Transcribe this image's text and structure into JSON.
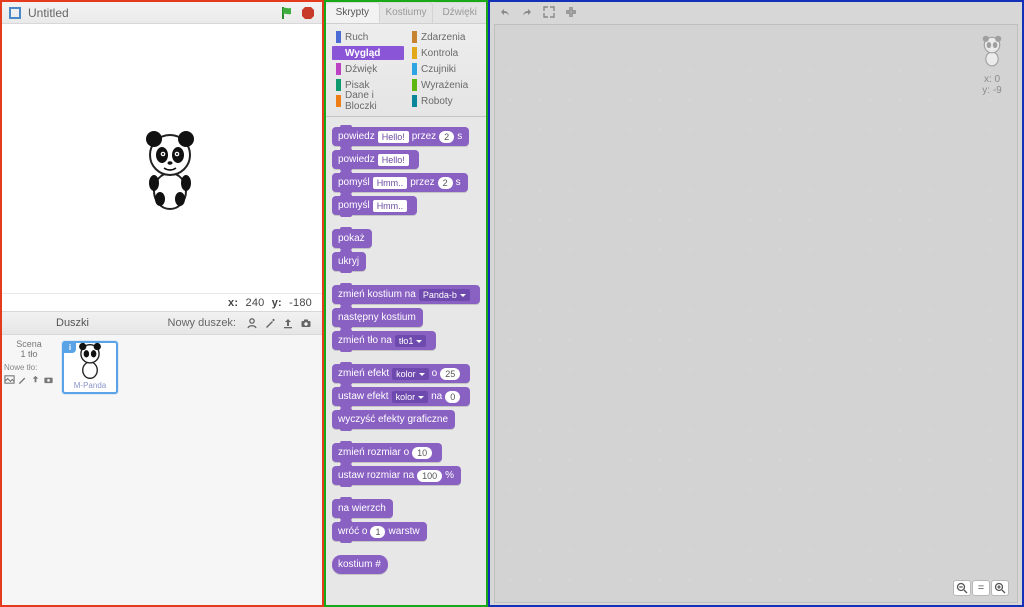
{
  "stage": {
    "title": "Untitled",
    "coords": {
      "x_label": "x:",
      "x": "240",
      "y_label": "y:",
      "y": "-180"
    }
  },
  "sprite_bar": {
    "title": "Duszki",
    "new_sprite_label": "Nowy duszek:"
  },
  "scene": {
    "label": "Scena",
    "sub": "1 tło",
    "new_bg_label": "Nowe tło:"
  },
  "sprite_thumb": {
    "label": "M-Panda",
    "badge": "i"
  },
  "tabs": [
    "Skrypty",
    "Kostiumy",
    "Dźwięki"
  ],
  "categories": [
    {
      "name": "Ruch",
      "color": "#4a6cd4"
    },
    {
      "name": "Zdarzenia",
      "color": "#c88330"
    },
    {
      "name": "Wygląd",
      "color": "#8a55d7",
      "selected": true
    },
    {
      "name": "Kontrola",
      "color": "#e1a91a"
    },
    {
      "name": "Dźwięk",
      "color": "#bb42c3"
    },
    {
      "name": "Czujniki",
      "color": "#2ca5e2"
    },
    {
      "name": "Pisak",
      "color": "#0e9a6c"
    },
    {
      "name": "Wyrażenia",
      "color": "#5cb712"
    },
    {
      "name": "Dane i Bloczki",
      "color": "#ee7d16"
    },
    {
      "name": "Roboty",
      "color": "#0a8698"
    }
  ],
  "blocks": [
    [
      {
        "parts": [
          {
            "t": "txt",
            "v": "powiedz"
          },
          {
            "t": "text",
            "v": "Hello!"
          },
          {
            "t": "txt",
            "v": "przez"
          },
          {
            "t": "num",
            "v": "2"
          },
          {
            "t": "txt",
            "v": "s"
          }
        ]
      },
      {
        "parts": [
          {
            "t": "txt",
            "v": "powiedz"
          },
          {
            "t": "text",
            "v": "Hello!"
          }
        ]
      },
      {
        "parts": [
          {
            "t": "txt",
            "v": "pomyśl"
          },
          {
            "t": "text",
            "v": "Hmm.."
          },
          {
            "t": "txt",
            "v": "przez"
          },
          {
            "t": "num",
            "v": "2"
          },
          {
            "t": "txt",
            "v": "s"
          }
        ]
      },
      {
        "parts": [
          {
            "t": "txt",
            "v": "pomyśl"
          },
          {
            "t": "text",
            "v": "Hmm.."
          }
        ]
      }
    ],
    [
      {
        "parts": [
          {
            "t": "txt",
            "v": "pokaż"
          }
        ]
      },
      {
        "parts": [
          {
            "t": "txt",
            "v": "ukryj"
          }
        ]
      }
    ],
    [
      {
        "parts": [
          {
            "t": "txt",
            "v": "zmień kostium na"
          },
          {
            "t": "menu",
            "v": "Panda-b"
          }
        ]
      },
      {
        "parts": [
          {
            "t": "txt",
            "v": "następny kostium"
          }
        ]
      },
      {
        "parts": [
          {
            "t": "txt",
            "v": "zmień tło na"
          },
          {
            "t": "menu",
            "v": "tło1"
          }
        ]
      }
    ],
    [
      {
        "parts": [
          {
            "t": "txt",
            "v": "zmień efekt"
          },
          {
            "t": "menu",
            "v": "kolor"
          },
          {
            "t": "txt",
            "v": "o"
          },
          {
            "t": "num",
            "v": "25"
          }
        ]
      },
      {
        "parts": [
          {
            "t": "txt",
            "v": "ustaw efekt"
          },
          {
            "t": "menu",
            "v": "kolor"
          },
          {
            "t": "txt",
            "v": "na"
          },
          {
            "t": "num",
            "v": "0"
          }
        ]
      },
      {
        "parts": [
          {
            "t": "txt",
            "v": "wyczyść efekty graficzne"
          }
        ]
      }
    ],
    [
      {
        "parts": [
          {
            "t": "txt",
            "v": "zmień rozmiar o"
          },
          {
            "t": "num",
            "v": "10"
          }
        ]
      },
      {
        "parts": [
          {
            "t": "txt",
            "v": "ustaw rozmiar na"
          },
          {
            "t": "num",
            "v": "100"
          },
          {
            "t": "txt",
            "v": "%"
          }
        ]
      }
    ],
    [
      {
        "parts": [
          {
            "t": "txt",
            "v": "na wierzch"
          }
        ]
      },
      {
        "parts": [
          {
            "t": "txt",
            "v": "wróć o"
          },
          {
            "t": "num",
            "v": "1"
          },
          {
            "t": "txt",
            "v": "warstw"
          }
        ]
      }
    ],
    [
      {
        "shape": "reporter",
        "parts": [
          {
            "t": "txt",
            "v": "kostium #"
          }
        ]
      }
    ]
  ],
  "script_info": {
    "x_label": "x:",
    "x": "0",
    "y_label": "y:",
    "y": "-9"
  },
  "zoom": {
    "out": "⊖",
    "reset": "=",
    "in": "⊕"
  }
}
